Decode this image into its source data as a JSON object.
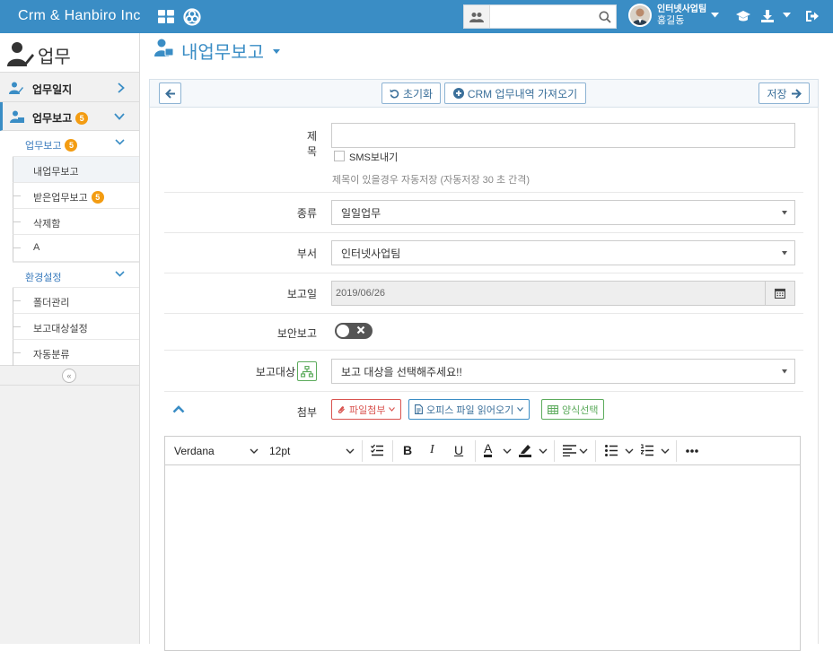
{
  "topbar": {
    "brand": "Crm & Hanbiro Inc",
    "search": {
      "value": "",
      "placeholder": ""
    },
    "user": {
      "department": "인터넷사업팀",
      "name": "홍길동"
    }
  },
  "sidebar": {
    "title": "업무",
    "items": [
      {
        "label": "업무일지",
        "badge": ""
      },
      {
        "label": "업무보고",
        "badge": "5"
      }
    ],
    "subtree": [
      {
        "label": "업무보고",
        "badge": "5",
        "type": "group"
      },
      {
        "label": "내업무보고",
        "badge": "",
        "type": "leaf",
        "current": true
      },
      {
        "label": "받은업무보고",
        "badge": "5",
        "type": "leaf"
      },
      {
        "label": "삭제함",
        "badge": "",
        "type": "leaf"
      },
      {
        "label": "A",
        "badge": "",
        "type": "leaf"
      },
      {
        "label": "환경설정",
        "badge": "",
        "type": "group"
      },
      {
        "label": "폴더관리",
        "badge": "",
        "type": "leaf"
      },
      {
        "label": "보고대상설정",
        "badge": "",
        "type": "leaf"
      },
      {
        "label": "자동분류",
        "badge": "",
        "type": "leaf"
      }
    ]
  },
  "main": {
    "title": "내업무보고",
    "toolbar": {
      "reset_label": "초기화",
      "crm_label": "CRM 업무내역 가져오기",
      "save_label": "저장"
    },
    "form": {
      "subject_label": "제목",
      "subject_value": "",
      "sms_label": "SMS보내기",
      "autosave_note": "제목이 있을경우 자동저장 (자동저장 30 초 간격)",
      "type_label": "종류",
      "type_value": "일일업무",
      "dept_label": "부서",
      "dept_value": "인터넷사업팀",
      "date_label": "보고일",
      "date_value": "2019/06/26",
      "secure_label": "보안보고",
      "secure_on": false,
      "target_label": "보고대상",
      "target_value": "보고 대상을 선택해주세요!!",
      "attach_label": "첨부",
      "attach_file_label": "파일첨부",
      "office_label": "오피스 파일 읽어오기",
      "form_select_label": "양식선택"
    },
    "editor": {
      "font_family": "Verdana",
      "font_size": "12pt",
      "body": ""
    }
  },
  "colors": {
    "brand": "#3a8dc5",
    "badge": "#f39c12",
    "danger": "#d9534f",
    "success": "#5cab5c"
  }
}
